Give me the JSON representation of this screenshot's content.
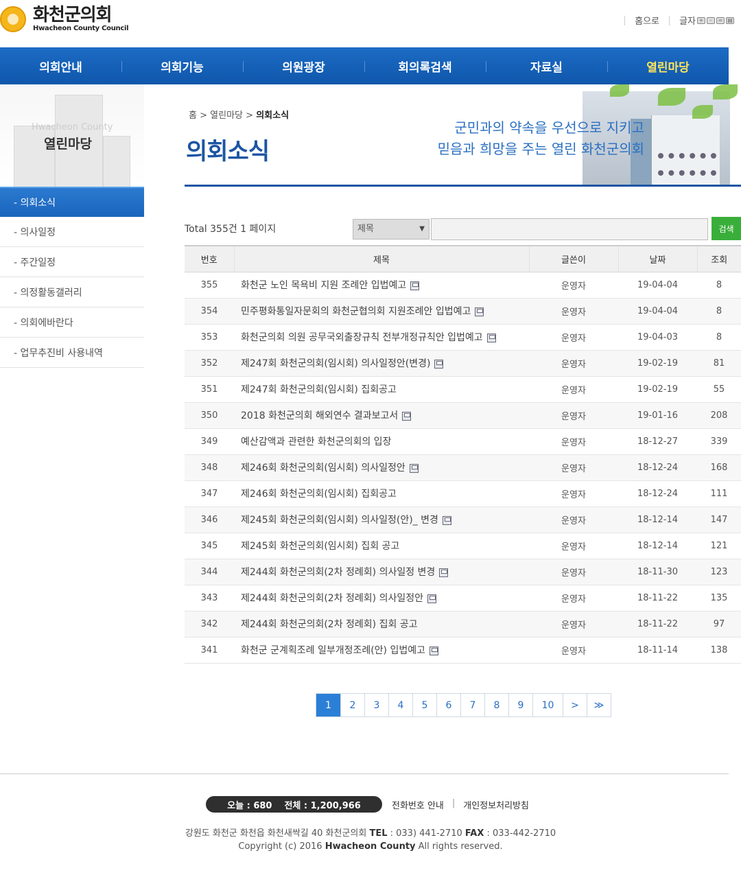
{
  "header": {
    "logo_ko": "화천군의회",
    "logo_en": "Hwacheon County Council",
    "home_link": "홈으로",
    "font_size_label": "글자"
  },
  "gnb": [
    "의회안내",
    "의회기능",
    "의원광장",
    "회의록검색",
    "자료실",
    "열린마당"
  ],
  "gnb_active_index": 5,
  "visual_left": {
    "en": "Hwacheon County",
    "ko": "열린마당"
  },
  "breadcrumb": {
    "home": "홈",
    "sep": ">",
    "section": "열린마당",
    "current": "의회소식"
  },
  "page_title": "의회소식",
  "slogan": {
    "line1": "군민과의 약속을 우선으로 지키고",
    "line2": "믿음과 희망을 주는 열린 화천군의회"
  },
  "lnb": [
    "- 의회소식",
    "- 의사일정",
    "- 주간일정",
    "- 의정활동갤러리",
    "- 의회에바란다",
    "- 업무추진비 사용내역"
  ],
  "search": {
    "total": "Total 355건 1 페이지",
    "select_value": "제목",
    "input_value": "",
    "button": "검색"
  },
  "table": {
    "headers": [
      "번호",
      "제목",
      "글쓴이",
      "날짜",
      "조회"
    ],
    "rows": [
      {
        "no": "355",
        "title": "화천군 노인 목욕비 지원 조례안 입법예고",
        "file": true,
        "writer": "운영자",
        "date": "19-04-04",
        "hits": "8"
      },
      {
        "no": "354",
        "title": "민주평화통일자문회의 화천군협의회 지원조례안 입법예고",
        "file": true,
        "writer": "운영자",
        "date": "19-04-04",
        "hits": "8"
      },
      {
        "no": "353",
        "title": "화천군의회 의원 공무국외출장규칙 전부개정규칙안 입법예고",
        "file": true,
        "writer": "운영자",
        "date": "19-04-03",
        "hits": "8"
      },
      {
        "no": "352",
        "title": "제247회 화천군의회(임시회) 의사일정안(변경)",
        "file": true,
        "writer": "운영자",
        "date": "19-02-19",
        "hits": "81"
      },
      {
        "no": "351",
        "title": "제247회 화천군의회(임시회) 집회공고",
        "file": false,
        "writer": "운영자",
        "date": "19-02-19",
        "hits": "55"
      },
      {
        "no": "350",
        "title": "2018 화천군의회 해외연수 결과보고서",
        "file": true,
        "writer": "운영자",
        "date": "19-01-16",
        "hits": "208"
      },
      {
        "no": "349",
        "title": "예산감액과 관련한 화천군의회의 입장",
        "file": false,
        "writer": "운영자",
        "date": "18-12-27",
        "hits": "339"
      },
      {
        "no": "348",
        "title": "제246회 화천군의회(임시회) 의사일정안",
        "file": true,
        "writer": "운영자",
        "date": "18-12-24",
        "hits": "168"
      },
      {
        "no": "347",
        "title": "제246회 화천군의회(임시회) 집회공고",
        "file": false,
        "writer": "운영자",
        "date": "18-12-24",
        "hits": "111"
      },
      {
        "no": "346",
        "title": "제245회 화천군의회(임시회) 의사일정(안)_ 변경",
        "file": true,
        "writer": "운영자",
        "date": "18-12-14",
        "hits": "147"
      },
      {
        "no": "345",
        "title": "제245회 화천군의회(임시회) 집회 공고",
        "file": false,
        "writer": "운영자",
        "date": "18-12-14",
        "hits": "121"
      },
      {
        "no": "344",
        "title": "제244회 화천군의회(2차 정례회) 의사일정 변경",
        "file": true,
        "writer": "운영자",
        "date": "18-11-30",
        "hits": "123"
      },
      {
        "no": "343",
        "title": "제244회 화천군의회(2차 정례회) 의사일정안",
        "file": true,
        "writer": "운영자",
        "date": "18-11-22",
        "hits": "135"
      },
      {
        "no": "342",
        "title": "제244회 화천군의회(2차 정례회) 집회 공고",
        "file": false,
        "writer": "운영자",
        "date": "18-11-22",
        "hits": "97"
      },
      {
        "no": "341",
        "title": "화천군 군계획조례 일부개정조례(안) 입법예고",
        "file": true,
        "writer": "운영자",
        "date": "18-11-14",
        "hits": "138"
      }
    ]
  },
  "pagination": {
    "pages": [
      "1",
      "2",
      "3",
      "4",
      "5",
      "6",
      "7",
      "8",
      "9",
      "10"
    ],
    "current": "1",
    "next": ">",
    "last": "≫"
  },
  "footer": {
    "today": "오늘 : 680",
    "total": "전체 : 1,200,966",
    "link_phone": "전화번호 안내",
    "link_sep": "|",
    "link_privacy": "개인정보처리방침",
    "address_prefix": "강원도 화천군 화천읍 화천새싹길 40 화천군의회 ",
    "tel_label": "TEL",
    "tel": " : 033) 441-2710 ",
    "fax_label": "FAX",
    "fax": " : 033-442-2710",
    "copyright_prefix": "Copyright (c) 2016 ",
    "copyright_name": "Hwacheon County",
    "copyright_suffix": " All rights reserved."
  },
  "colors": {
    "primary": "#1c55a3",
    "nav": "#1d6bc4",
    "accent_active": "#ffe55a",
    "search_button": "#3aae3a"
  }
}
